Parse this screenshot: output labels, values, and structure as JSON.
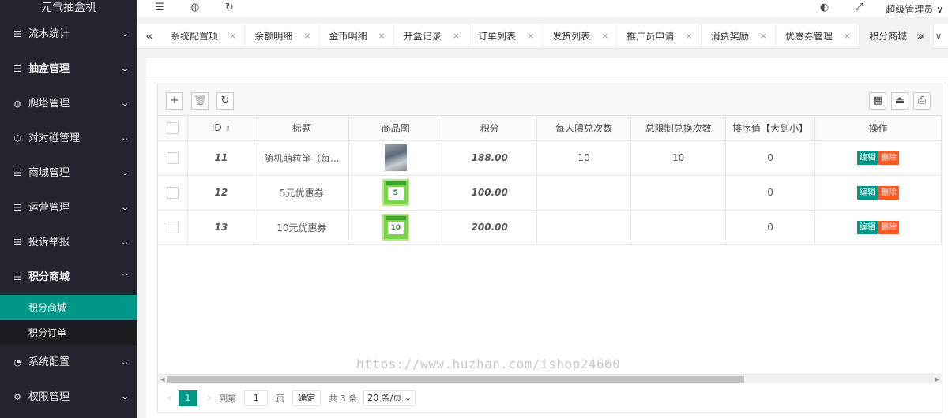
{
  "sidebar": {
    "logo": "元气抽盒机",
    "items": [
      {
        "label": "流水统计",
        "icon": "list-icon"
      },
      {
        "label": "抽盒管理",
        "icon": "list-icon"
      },
      {
        "label": "爬塔管理",
        "icon": "globe-icon"
      },
      {
        "label": "对对碰管理",
        "icon": "cube-icon"
      },
      {
        "label": "商城管理",
        "icon": "list-icon"
      },
      {
        "label": "运营管理",
        "icon": "list-icon"
      },
      {
        "label": "投诉举报",
        "icon": "list-icon"
      },
      {
        "label": "积分商城",
        "icon": "list-icon"
      }
    ],
    "sub_items": [
      {
        "label": "积分商城",
        "active": true
      },
      {
        "label": "积分订单",
        "active": false
      }
    ],
    "items_after": [
      {
        "label": "系统配置",
        "icon": "clock-icon"
      },
      {
        "label": "权限管理",
        "icon": "gear-icon"
      }
    ]
  },
  "header": {
    "user": "超级管理员"
  },
  "tabs": [
    {
      "label": "系统配置项"
    },
    {
      "label": "余额明细"
    },
    {
      "label": "金币明细"
    },
    {
      "label": "开盒记录"
    },
    {
      "label": "订单列表"
    },
    {
      "label": "发货列表"
    },
    {
      "label": "推广员申请"
    },
    {
      "label": "消费奖励"
    },
    {
      "label": "优惠券管理"
    },
    {
      "label": "积分商城",
      "active": true
    }
  ],
  "table": {
    "headers": [
      "ID",
      "标题",
      "商品图",
      "积分",
      "每人限兑次数",
      "总限制兑换次数",
      "排序值【大到小】",
      "操作"
    ],
    "rows": [
      {
        "id": "11",
        "title": "随机萌粒笔（每...",
        "image": "photo",
        "points": "188.00",
        "per_user": "10",
        "total_limit": "10",
        "sort": "0"
      },
      {
        "id": "12",
        "title": "5元优惠券",
        "image": "coupon",
        "coupon_value": "5",
        "points": "100.00",
        "per_user": "",
        "total_limit": "",
        "sort": "0"
      },
      {
        "id": "13",
        "title": "10元优惠券",
        "image": "coupon",
        "coupon_value": "10",
        "points": "200.00",
        "per_user": "",
        "total_limit": "",
        "sort": "0"
      }
    ],
    "edit_label": "编辑",
    "delete_label": "删除"
  },
  "pager": {
    "current": "1",
    "goto_label": "到第",
    "page_input": "1",
    "page_unit": "页",
    "confirm": "确定",
    "total": "共 3 条",
    "page_size": "20 条/页"
  },
  "watermark": "https://www.huzhan.com/ishop24660",
  "colors": {
    "sidebar_bg": "#23262e",
    "accent": "#009688",
    "danger": "#ff5722"
  }
}
